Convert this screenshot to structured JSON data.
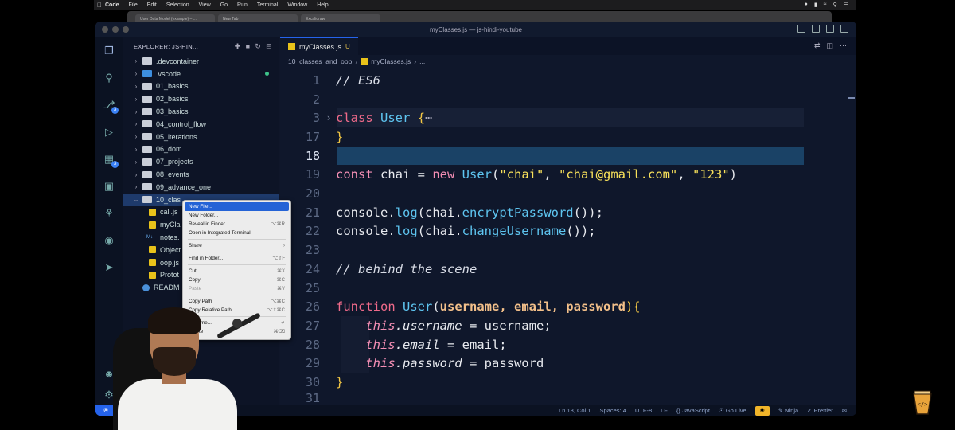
{
  "menubar": {
    "app": "Code",
    "items": [
      "File",
      "Edit",
      "Selection",
      "View",
      "Go",
      "Run",
      "Terminal",
      "Window",
      "Help"
    ]
  },
  "browser_tabs": [
    "User Data Model (example) – ...",
    "New Tab",
    "Excalidraw"
  ],
  "window": {
    "title": "myClasses.js — js-hindi-youtube"
  },
  "sidebar": {
    "title": "EXPLORER: JS-HIN...",
    "items": [
      {
        "label": ".devcontainer",
        "kind": "folder"
      },
      {
        "label": ".vscode",
        "kind": "folder"
      },
      {
        "label": "01_basics",
        "kind": "folder"
      },
      {
        "label": "02_basics",
        "kind": "folder"
      },
      {
        "label": "03_basics",
        "kind": "folder"
      },
      {
        "label": "04_control_flow",
        "kind": "folder"
      },
      {
        "label": "05_iterations",
        "kind": "folder"
      },
      {
        "label": "06_dom",
        "kind": "folder"
      },
      {
        "label": "07_projects",
        "kind": "folder"
      },
      {
        "label": "08_events",
        "kind": "folder"
      },
      {
        "label": "09_advance_one",
        "kind": "folder"
      },
      {
        "label": "10_clas",
        "kind": "folder-open"
      },
      {
        "label": "call.js",
        "kind": "js"
      },
      {
        "label": "myCla",
        "kind": "js"
      },
      {
        "label": "notes.",
        "kind": "md"
      },
      {
        "label": "Object",
        "kind": "js"
      },
      {
        "label": "oop.js",
        "kind": "js"
      },
      {
        "label": "Protot",
        "kind": "js"
      },
      {
        "label": "READM",
        "kind": "info"
      }
    ]
  },
  "editor": {
    "tab": {
      "label": "myClasses.js",
      "status": "U"
    },
    "breadcrumb": [
      "10_classes_and_oop",
      "myClasses.js",
      "..."
    ],
    "line_numbers": [
      "1",
      "2",
      "3",
      "17",
      "18",
      "19",
      "20",
      "21",
      "22",
      "23",
      "24",
      "25",
      "26",
      "27",
      "28",
      "29",
      "30",
      "31"
    ],
    "tokens": {
      "l1": "// ES6",
      "l3_kw": "class",
      "l3_name": "User",
      "l3_brace": "{",
      "l3_dots": "⋯",
      "l17": "}",
      "l19_const": "const",
      "l19_var": " chai = ",
      "l19_new": "new",
      "l19_cls": "User",
      "l19_open": "(",
      "l19_s1": "\"chai\"",
      "l19_c1": ", ",
      "l19_s2": "\"chai@gmail.com\"",
      "l19_c2": ", ",
      "l19_s3": "\"123\"",
      "l19_close": ")",
      "l21_a": "console.",
      "l21_fn": "log",
      "l21_b": "(chai.",
      "l21_fn2": "encryptPassword",
      "l21_c": "());",
      "l22_a": "console.",
      "l22_fn": "log",
      "l22_b": "(chai.",
      "l22_fn2": "changeUsername",
      "l22_c": "());",
      "l24": "// behind the scene",
      "l26_kw": "function",
      "l26_name": "User",
      "l26_open": "(",
      "l26_p": "username, email, password",
      "l26_close": "){",
      "l27_this": "this",
      "l27_prop": ".username",
      "l27_rest": " = username;",
      "l28_this": "this",
      "l28_prop": ".email",
      "l28_rest": " = email;",
      "l29_this": "this",
      "l29_prop": ".password",
      "l29_rest": " = password",
      "l30": "}"
    }
  },
  "context_menu": {
    "items": [
      {
        "label": "New File...",
        "shortcut": "",
        "state": "active"
      },
      {
        "label": "New Folder...",
        "shortcut": ""
      },
      {
        "label": "Reveal in Finder",
        "shortcut": "⌥⌘R"
      },
      {
        "label": "Open in Integrated Terminal",
        "shortcut": ""
      },
      {
        "sep": true
      },
      {
        "label": "Share",
        "shortcut": "›"
      },
      {
        "sep": true
      },
      {
        "label": "Find in Folder...",
        "shortcut": "⌥⇧F"
      },
      {
        "sep": true
      },
      {
        "label": "Cut",
        "shortcut": "⌘X"
      },
      {
        "label": "Copy",
        "shortcut": "⌘C"
      },
      {
        "label": "Paste",
        "shortcut": "⌘V",
        "state": "disabled"
      },
      {
        "sep": true
      },
      {
        "label": "Copy Path",
        "shortcut": "⌥⌘C"
      },
      {
        "label": "Copy Relative Path",
        "shortcut": "⌥⇧⌘C"
      },
      {
        "sep": true
      },
      {
        "label": "Rename...",
        "shortcut": "↵"
      },
      {
        "label": "Delete",
        "shortcut": "⌘⌫"
      }
    ]
  },
  "statusbar": {
    "position": "Ln 18, Col 1",
    "spaces": "Spaces: 4",
    "encoding": "UTF-8",
    "eol": "LF",
    "language": "{} JavaScript",
    "golive": "Go Live",
    "ninja": "Ninja",
    "prettier": "✓ Prettier"
  },
  "colors": {
    "accent": "#2563eb",
    "keyword": "#f58fb5",
    "string": "#f7e05a",
    "class": "#5ec5f0",
    "editor_bg": "#0f172b"
  }
}
